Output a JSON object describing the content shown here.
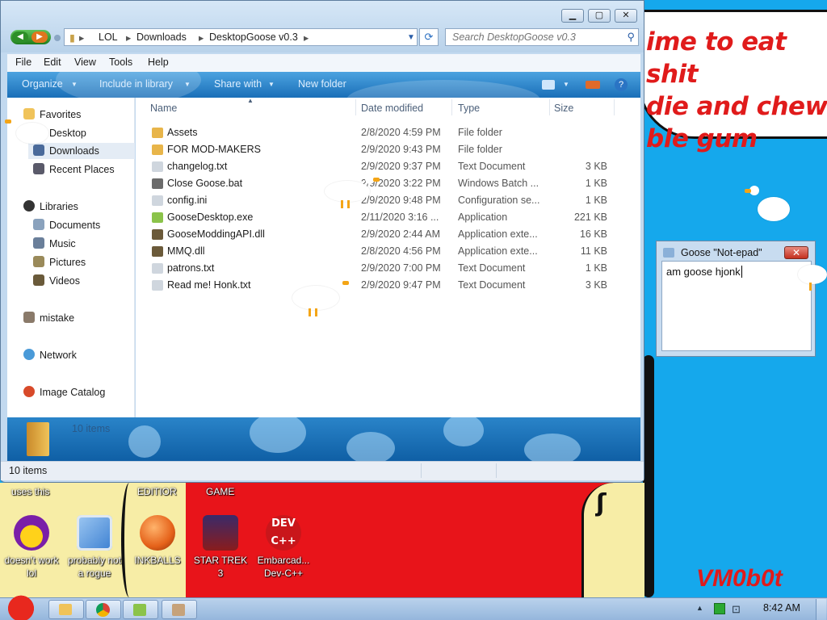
{
  "desktop": {
    "bubble_text": "ime to eat shit\ndie and chew\nble gum",
    "labels_top": {
      "left": "uses this",
      "editor": "EDITIOR",
      "game": "GAME"
    },
    "watermark": "VM0b0t",
    "icons": [
      {
        "name": "doesn't work lol",
        "icon": "yahoo-messenger-icon",
        "color": "#7a1fa8"
      },
      {
        "name": "probably not a rogue",
        "icon": "monitor-gear-icon",
        "color": "#3b7fd1"
      },
      {
        "name": "INKBALLS",
        "icon": "inkball-icon",
        "color": "#e5621a"
      },
      {
        "name": "STAR TREK 3",
        "icon": "star-trek-icon",
        "color": "#8a1c1c"
      },
      {
        "name": "Embarcad... Dev-C++",
        "icon": "devcpp-icon",
        "color": "#c9161b"
      }
    ]
  },
  "explorer": {
    "breadcrumb": [
      "LOL",
      "Downloads",
      "DesktopGoose v0.3"
    ],
    "search_placeholder": "Search DesktopGoose v0.3",
    "menu": [
      "File",
      "Edit",
      "View",
      "Tools",
      "Help"
    ],
    "commands": [
      "Organize",
      "Include in library",
      "Share with",
      "New folder"
    ],
    "nav": {
      "favorites": "Favorites",
      "favorites_items": [
        "Desktop",
        "Downloads",
        "Recent Places"
      ],
      "libraries": "Libraries",
      "libraries_items": [
        "Documents",
        "Music",
        "Pictures",
        "Videos"
      ],
      "mistake": "mistake",
      "network": "Network",
      "image_catalog": "Image Catalog"
    },
    "columns": {
      "name": "Name",
      "date": "Date modified",
      "type": "Type",
      "size": "Size"
    },
    "files": [
      {
        "name": "Assets",
        "date": "2/8/2020 4:59 PM",
        "type": "File folder",
        "size": "",
        "icon": "folder-icon",
        "color": "#e8b54a"
      },
      {
        "name": "FOR MOD-MAKERS",
        "date": "2/9/2020 9:43 PM",
        "type": "File folder",
        "size": "",
        "icon": "folder-icon",
        "color": "#e8b54a"
      },
      {
        "name": "changelog.txt",
        "date": "2/9/2020 9:37 PM",
        "type": "Text Document",
        "size": "3 KB",
        "icon": "text-file-icon",
        "color": "#cfd6de"
      },
      {
        "name": "Close Goose.bat",
        "date": "2/9/2020 3:22 PM",
        "type": "Windows Batch ...",
        "size": "1 KB",
        "icon": "batch-file-icon",
        "color": "#6b6b6b"
      },
      {
        "name": "config.ini",
        "date": "2/9/2020 9:48 PM",
        "type": "Configuration se...",
        "size": "1 KB",
        "icon": "config-file-icon",
        "color": "#cfd6de"
      },
      {
        "name": "GooseDesktop.exe",
        "date": "2/11/2020 3:16 ...",
        "type": "Application",
        "size": "221 KB",
        "icon": "goose-app-icon",
        "color": "#8bc34a"
      },
      {
        "name": "GooseModdingAPI.dll",
        "date": "2/9/2020 2:44 AM",
        "type": "Application exte...",
        "size": "16 KB",
        "icon": "dll-icon",
        "color": "#6b5a3a"
      },
      {
        "name": "MMQ.dll",
        "date": "2/8/2020 4:56 PM",
        "type": "Application exte...",
        "size": "11 KB",
        "icon": "dll-icon",
        "color": "#6b5a3a"
      },
      {
        "name": "patrons.txt",
        "date": "2/9/2020 7:00 PM",
        "type": "Text Document",
        "size": "1 KB",
        "icon": "text-file-icon",
        "color": "#cfd6de"
      },
      {
        "name": "Read me! Honk.txt",
        "date": "2/9/2020 9:47 PM",
        "type": "Text Document",
        "size": "3 KB",
        "icon": "text-file-icon",
        "color": "#cfd6de"
      }
    ],
    "details_count": "10 items",
    "status": "10 items"
  },
  "notepad": {
    "title": "Goose \"Not-epad\"",
    "close": "✕",
    "text": "am goose hjonk"
  },
  "taskbar": {
    "clock": "8:42 AM"
  }
}
